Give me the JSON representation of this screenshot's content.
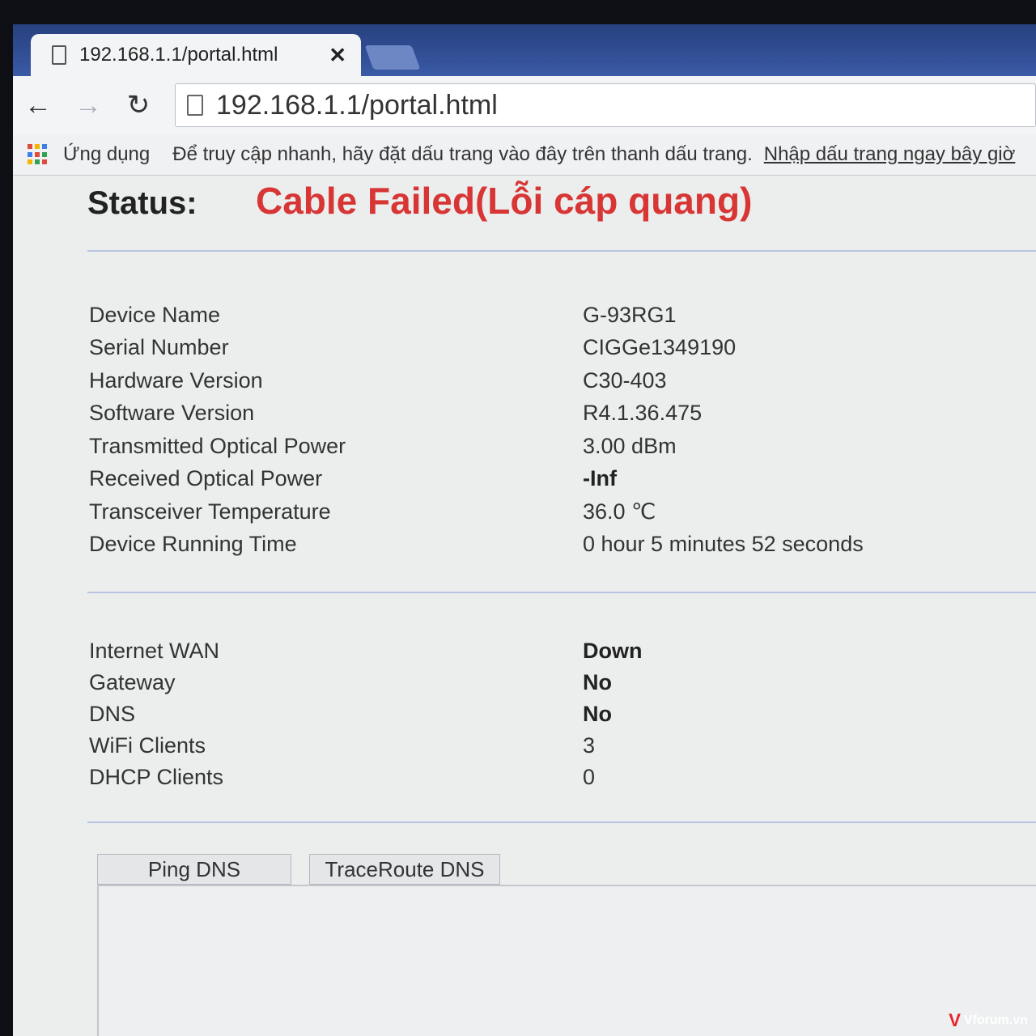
{
  "browser": {
    "tab": {
      "title": "192.168.1.1/portal.html",
      "close_label": "✕"
    },
    "toolbar": {
      "back": "←",
      "forward": "→",
      "reload": "↻",
      "url": "192.168.1.1/portal.html"
    },
    "bookmarks": {
      "apps_label": "Ứng dụng",
      "hint": "Để truy cập nhanh, hãy đặt dấu trang vào đây trên thanh dấu trang.",
      "link": "Nhập dấu trang ngay bây giờ"
    }
  },
  "status": {
    "label": "Status:",
    "value": "Cable Failed(Lỗi cáp quang)",
    "color": "#d83535"
  },
  "device_info": [
    {
      "key": "Device Name",
      "value": "G-93RG1",
      "bold": false
    },
    {
      "key": "Serial Number",
      "value": "CIGGe1349190",
      "bold": false
    },
    {
      "key": "Hardware Version",
      "value": "C30-403",
      "bold": false
    },
    {
      "key": "Software Version",
      "value": "R4.1.36.475",
      "bold": false
    },
    {
      "key": "Transmitted Optical Power",
      "value": "3.00 dBm",
      "bold": false
    },
    {
      "key": "Received Optical Power",
      "value": "-Inf",
      "bold": true
    },
    {
      "key": "Transceiver Temperature",
      "value": "36.0 ℃",
      "bold": false
    },
    {
      "key": "Device Running Time",
      "value": "0 hour 5 minutes 52 seconds",
      "bold": false
    }
  ],
  "network_info": [
    {
      "key": "Internet WAN",
      "value": "Down",
      "bold": true
    },
    {
      "key": "Gateway",
      "value": "No",
      "bold": true
    },
    {
      "key": "DNS",
      "value": "No",
      "bold": true
    },
    {
      "key": "WiFi Clients",
      "value": "3",
      "bold": false
    },
    {
      "key": "DHCP Clients",
      "value": "0",
      "bold": false
    }
  ],
  "buttons": {
    "ping": "Ping DNS",
    "traceroute": "TraceRoute DNS"
  },
  "watermark": {
    "mark": "V",
    "text": "Vforum.vn"
  }
}
